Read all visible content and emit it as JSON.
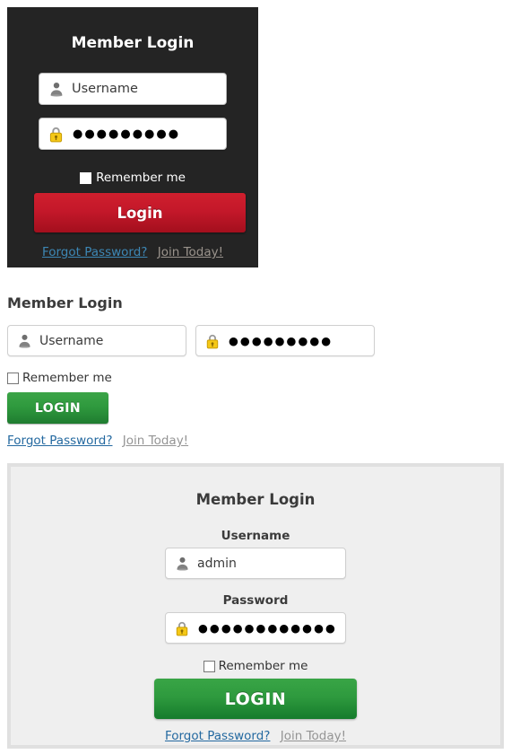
{
  "panels": {
    "dark": {
      "title": "Member Login",
      "username_placeholder": "Username",
      "username_value": "",
      "password_mask": "●●●●●●●●●",
      "remember_label": "Remember me",
      "remember_checked": false,
      "login_label": "Login",
      "forgot_label": "Forgot Password?",
      "join_label": "Join Today!",
      "user_icon": "user-icon",
      "lock_icon": "lock-icon",
      "bg_color": "#242424",
      "button_color": "#c4182a",
      "forgot_color": "#3d87b5",
      "join_color": "#9a938c"
    },
    "plain": {
      "title": "Member Login",
      "username_placeholder": "Username",
      "username_value": "",
      "password_mask": "●●●●●●●●●",
      "remember_label": "Remember me",
      "remember_checked": false,
      "login_label": "LOGIN",
      "forgot_label": "Forgot Password?",
      "join_label": "Join Today!",
      "user_icon": "user-icon",
      "lock_icon": "lock-icon",
      "button_color": "#2f9a3e",
      "forgot_color": "#2469a0",
      "join_color": "#949494"
    },
    "boxed": {
      "title": "Member Login",
      "username_label": "Username",
      "username_value": "admin",
      "password_label": "Password",
      "password_mask": "●●●●●●●●●●●●●●●",
      "remember_label": "Remember me",
      "remember_checked": false,
      "login_label": "LOGIN",
      "forgot_label": "Forgot Password?",
      "join_label": "Join Today!",
      "user_icon": "user-icon",
      "lock_icon": "lock-icon",
      "bg_color": "#efefef",
      "border_color": "#e0e0e0",
      "button_color": "#2e9a3e",
      "forgot_color": "#2469a0",
      "join_color": "#949494"
    }
  }
}
